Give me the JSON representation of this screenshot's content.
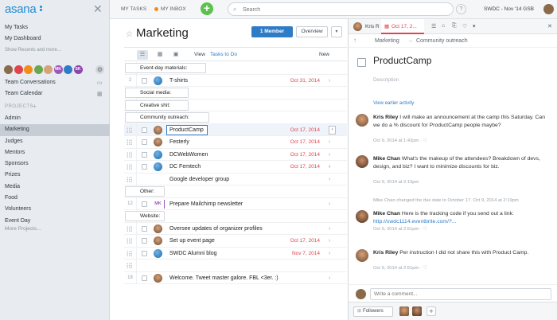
{
  "app": {
    "logo_text": "asana",
    "workspace": "SWDC - Nov '14 GSB"
  },
  "colors": {
    "accent_blue": "#2f7cc6",
    "overdue_red": "#e0444d",
    "new_green": "#5cc24d",
    "inbox_orange": "#f48c1c",
    "sidebar_bg": "#e8ebef"
  },
  "sidebar": {
    "close_icon": "close-icon",
    "links": [
      "My Tasks",
      "My Dashboard"
    ],
    "recents": "Show Recents and more...",
    "member_avatars": [
      {
        "label": "",
        "color": "#8a6a4a"
      },
      {
        "label": "",
        "color": "#e0444d"
      },
      {
        "label": "",
        "color": "#f48c1c"
      },
      {
        "label": "",
        "color": "#6aa84f"
      },
      {
        "label": "",
        "color": "#d6a27a"
      },
      {
        "label": "MK",
        "color": "#9b59b6"
      },
      {
        "label": "",
        "color": "#2f7cc6"
      },
      {
        "label": "SK",
        "color": "#8e44ad"
      }
    ],
    "team_conversations": "Team Conversations",
    "team_calendar": "Team Calendar",
    "projects_header": "PROJECTS",
    "projects": [
      "Admin",
      "Marketing",
      "Judges",
      "Mentors",
      "Sponsors",
      "Prizes",
      "Media",
      "Food",
      "Volunteers",
      "Event Day"
    ],
    "active_project": "Marketing",
    "more_projects": "More Projects..."
  },
  "topbar": {
    "my_tasks": "MY TASKS",
    "my_inbox": "MY INBOX",
    "new_button": "+",
    "search_placeholder": "Search",
    "help": "?"
  },
  "project": {
    "title": "Marketing",
    "member_button": "1 Member",
    "overview_button": "Overview",
    "caret": "▾"
  },
  "list_toolbar": {
    "view_label": "View",
    "filter_label": "Tasks to Do",
    "new_label": "New"
  },
  "rows": [
    {
      "kind": "section",
      "num": "",
      "name": "Event-day materials:"
    },
    {
      "kind": "task",
      "num": "2",
      "name": "T-shirts",
      "date": "Oct 31, 2014",
      "avatar": "globe",
      "check": false
    },
    {
      "kind": "section",
      "num": "",
      "name": "Social media:"
    },
    {
      "kind": "section",
      "num": "",
      "name": "Creative shit:"
    },
    {
      "kind": "section",
      "num": "",
      "name": "Community outreach:"
    },
    {
      "kind": "task",
      "num": "",
      "name": "ProductCamp",
      "date": "Oct 17, 2014",
      "avatar": "photo",
      "check": true,
      "selected": true
    },
    {
      "kind": "task",
      "num": "",
      "name": "Festerly",
      "date": "Oct 17, 2014",
      "avatar": "photo",
      "check": false
    },
    {
      "kind": "task",
      "num": "",
      "name": "DCWebWomen",
      "date": "Oct 17, 2014",
      "avatar": "globe",
      "check": false
    },
    {
      "kind": "task",
      "num": "",
      "name": "DC Femtech",
      "date": "Oct 17, 2014",
      "avatar": "globe",
      "check": true,
      "chev_blue": true
    },
    {
      "kind": "task",
      "num": "",
      "name": "Google developer group",
      "date": "",
      "avatar": "",
      "check": false
    },
    {
      "kind": "section",
      "num": "",
      "name": "Other:"
    },
    {
      "kind": "task",
      "num": "12",
      "name": "Prepare Mailchimp newsletter",
      "date": "",
      "avatar": "init",
      "initials": "MK",
      "check": false
    },
    {
      "kind": "section",
      "num": "",
      "name": "Website:"
    },
    {
      "kind": "task",
      "num": "",
      "name": "Oversee updates of organizer profiles",
      "date": "",
      "avatar": "photo",
      "check": false
    },
    {
      "kind": "task",
      "num": "",
      "name": "Set up event page",
      "date": "Oct 17, 2014",
      "avatar": "photo",
      "check": false
    },
    {
      "kind": "task",
      "num": "",
      "name": "SWDC Alumni blog",
      "date": "Nov 7, 2014",
      "avatar": "globe",
      "check": false
    },
    {
      "kind": "task",
      "num": "",
      "name": "",
      "date": "",
      "avatar": "",
      "check": false
    },
    {
      "kind": "task",
      "num": "18",
      "name": "Welcome. Tweet master galore. FBL <3er. :)",
      "date": "",
      "avatar": "photo",
      "check": false
    }
  ],
  "detail": {
    "assignee": "Kris R",
    "due_date": "Oct 17, 2...",
    "breadcrumb_project": "Marketing",
    "breadcrumb_sep": "→",
    "breadcrumb_section": "Community outreach",
    "title": "ProductCamp",
    "description_placeholder": "Description",
    "view_earlier": "View earlier activity",
    "stories": [
      {
        "author": "Kris Riley",
        "text": "I will make an announcement at the camp this Saturday. Can we do a % discount for ProductCamp people maybe?",
        "meta": "Oct 9, 2014 at 1:42pm ·  ♡",
        "avatar": "kr"
      },
      {
        "author": "Mike Chan",
        "text": "What's the makeup of the attendees? Breakdown of devs, design, and biz? I want to minimize discounts for biz.",
        "meta": "Oct 9, 2014 at 2:15pm",
        "avatar": "mc"
      },
      {
        "author": "Mike Chan",
        "text": "Here is the tracking code if you send out a link: ",
        "link": "http://swdc1114.eventbrite.com/?...",
        "meta": "Oct 9, 2014 at 2:51pm ·  ♡",
        "avatar": "mc"
      },
      {
        "author": "Kris Riley",
        "text": "Per instruction I did not share this with Product Camp.",
        "meta": "Oct 9, 2014 at 2:51pm ·  ♡",
        "avatar": "kr"
      }
    ],
    "system_line": "Mike Chan changed the due date to October 17.   Oct 9, 2014 at 2:19pm",
    "comment_placeholder": "Write a comment...",
    "followers_label": "Followers",
    "add_follower": "+"
  }
}
